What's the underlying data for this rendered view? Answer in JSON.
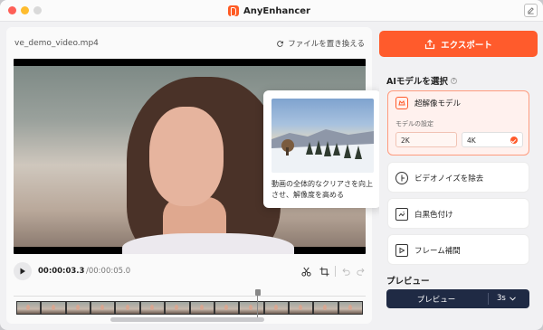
{
  "app": {
    "title": "AnyEnhancer"
  },
  "editor": {
    "filename": "ve_demo_video.mp4",
    "replace_label": "ファイルを置き換える",
    "time_current": "00:00:03.3",
    "time_total": "/00:00:05.0",
    "playhead_fraction": 0.66
  },
  "tooltip": {
    "text": "動画の全体的なクリアさを向上させ、解像度を高める"
  },
  "export": {
    "label": "エクスポート"
  },
  "ai_models": {
    "title": "AIモデルを選択",
    "super_res": {
      "label": "超解像モデル",
      "setting_label": "モデルの設定",
      "options": [
        "2K",
        "4K"
      ],
      "selected": "4K"
    },
    "items": [
      {
        "label": "ビデオノイズを除去",
        "icon": "denoise-icon"
      },
      {
        "label": "白黒色付け",
        "icon": "colorize-icon"
      },
      {
        "label": "フレーム補間",
        "icon": "interpolate-icon"
      }
    ]
  },
  "preview": {
    "title": "プレビュー",
    "button_label": "プレビュー",
    "duration": "3s"
  },
  "colors": {
    "accent": "#ff5b2c",
    "dark": "#1f2a44"
  }
}
